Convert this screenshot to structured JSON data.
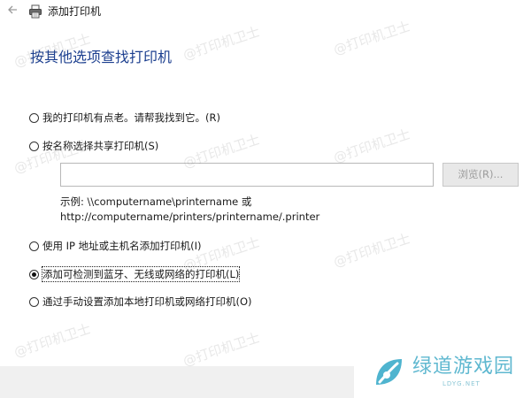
{
  "window": {
    "title": "添加打印机"
  },
  "page": {
    "title": "按其他选项查找打印机"
  },
  "options": [
    {
      "label": "我的打印机有点老。请帮我找到它。(R)",
      "checked": false
    },
    {
      "label": "按名称选择共享打印机(S)",
      "checked": false
    },
    {
      "label": "使用 IP 地址或主机名添加打印机(I)",
      "checked": false
    },
    {
      "label": "添加可检测到蓝牙、无线或网络的打印机(L)",
      "checked": true
    },
    {
      "label": "通过手动设置添加本地打印机或网络打印机(O)",
      "checked": false
    }
  ],
  "share": {
    "input_value": "",
    "browse_label": "浏览(R)...",
    "example_line1": "示例: \\\\computername\\printername 或",
    "example_line2": "http://computername/printers/printername/.printer"
  },
  "watermark": {
    "text": "@打印机卫士"
  },
  "brand": {
    "name": "绿道游戏园",
    "domain": "LDYG.NET",
    "color": "#5fb8d0"
  },
  "colors": {
    "title_blue": "#1c3f8f",
    "footer": "#f0f0f0"
  }
}
